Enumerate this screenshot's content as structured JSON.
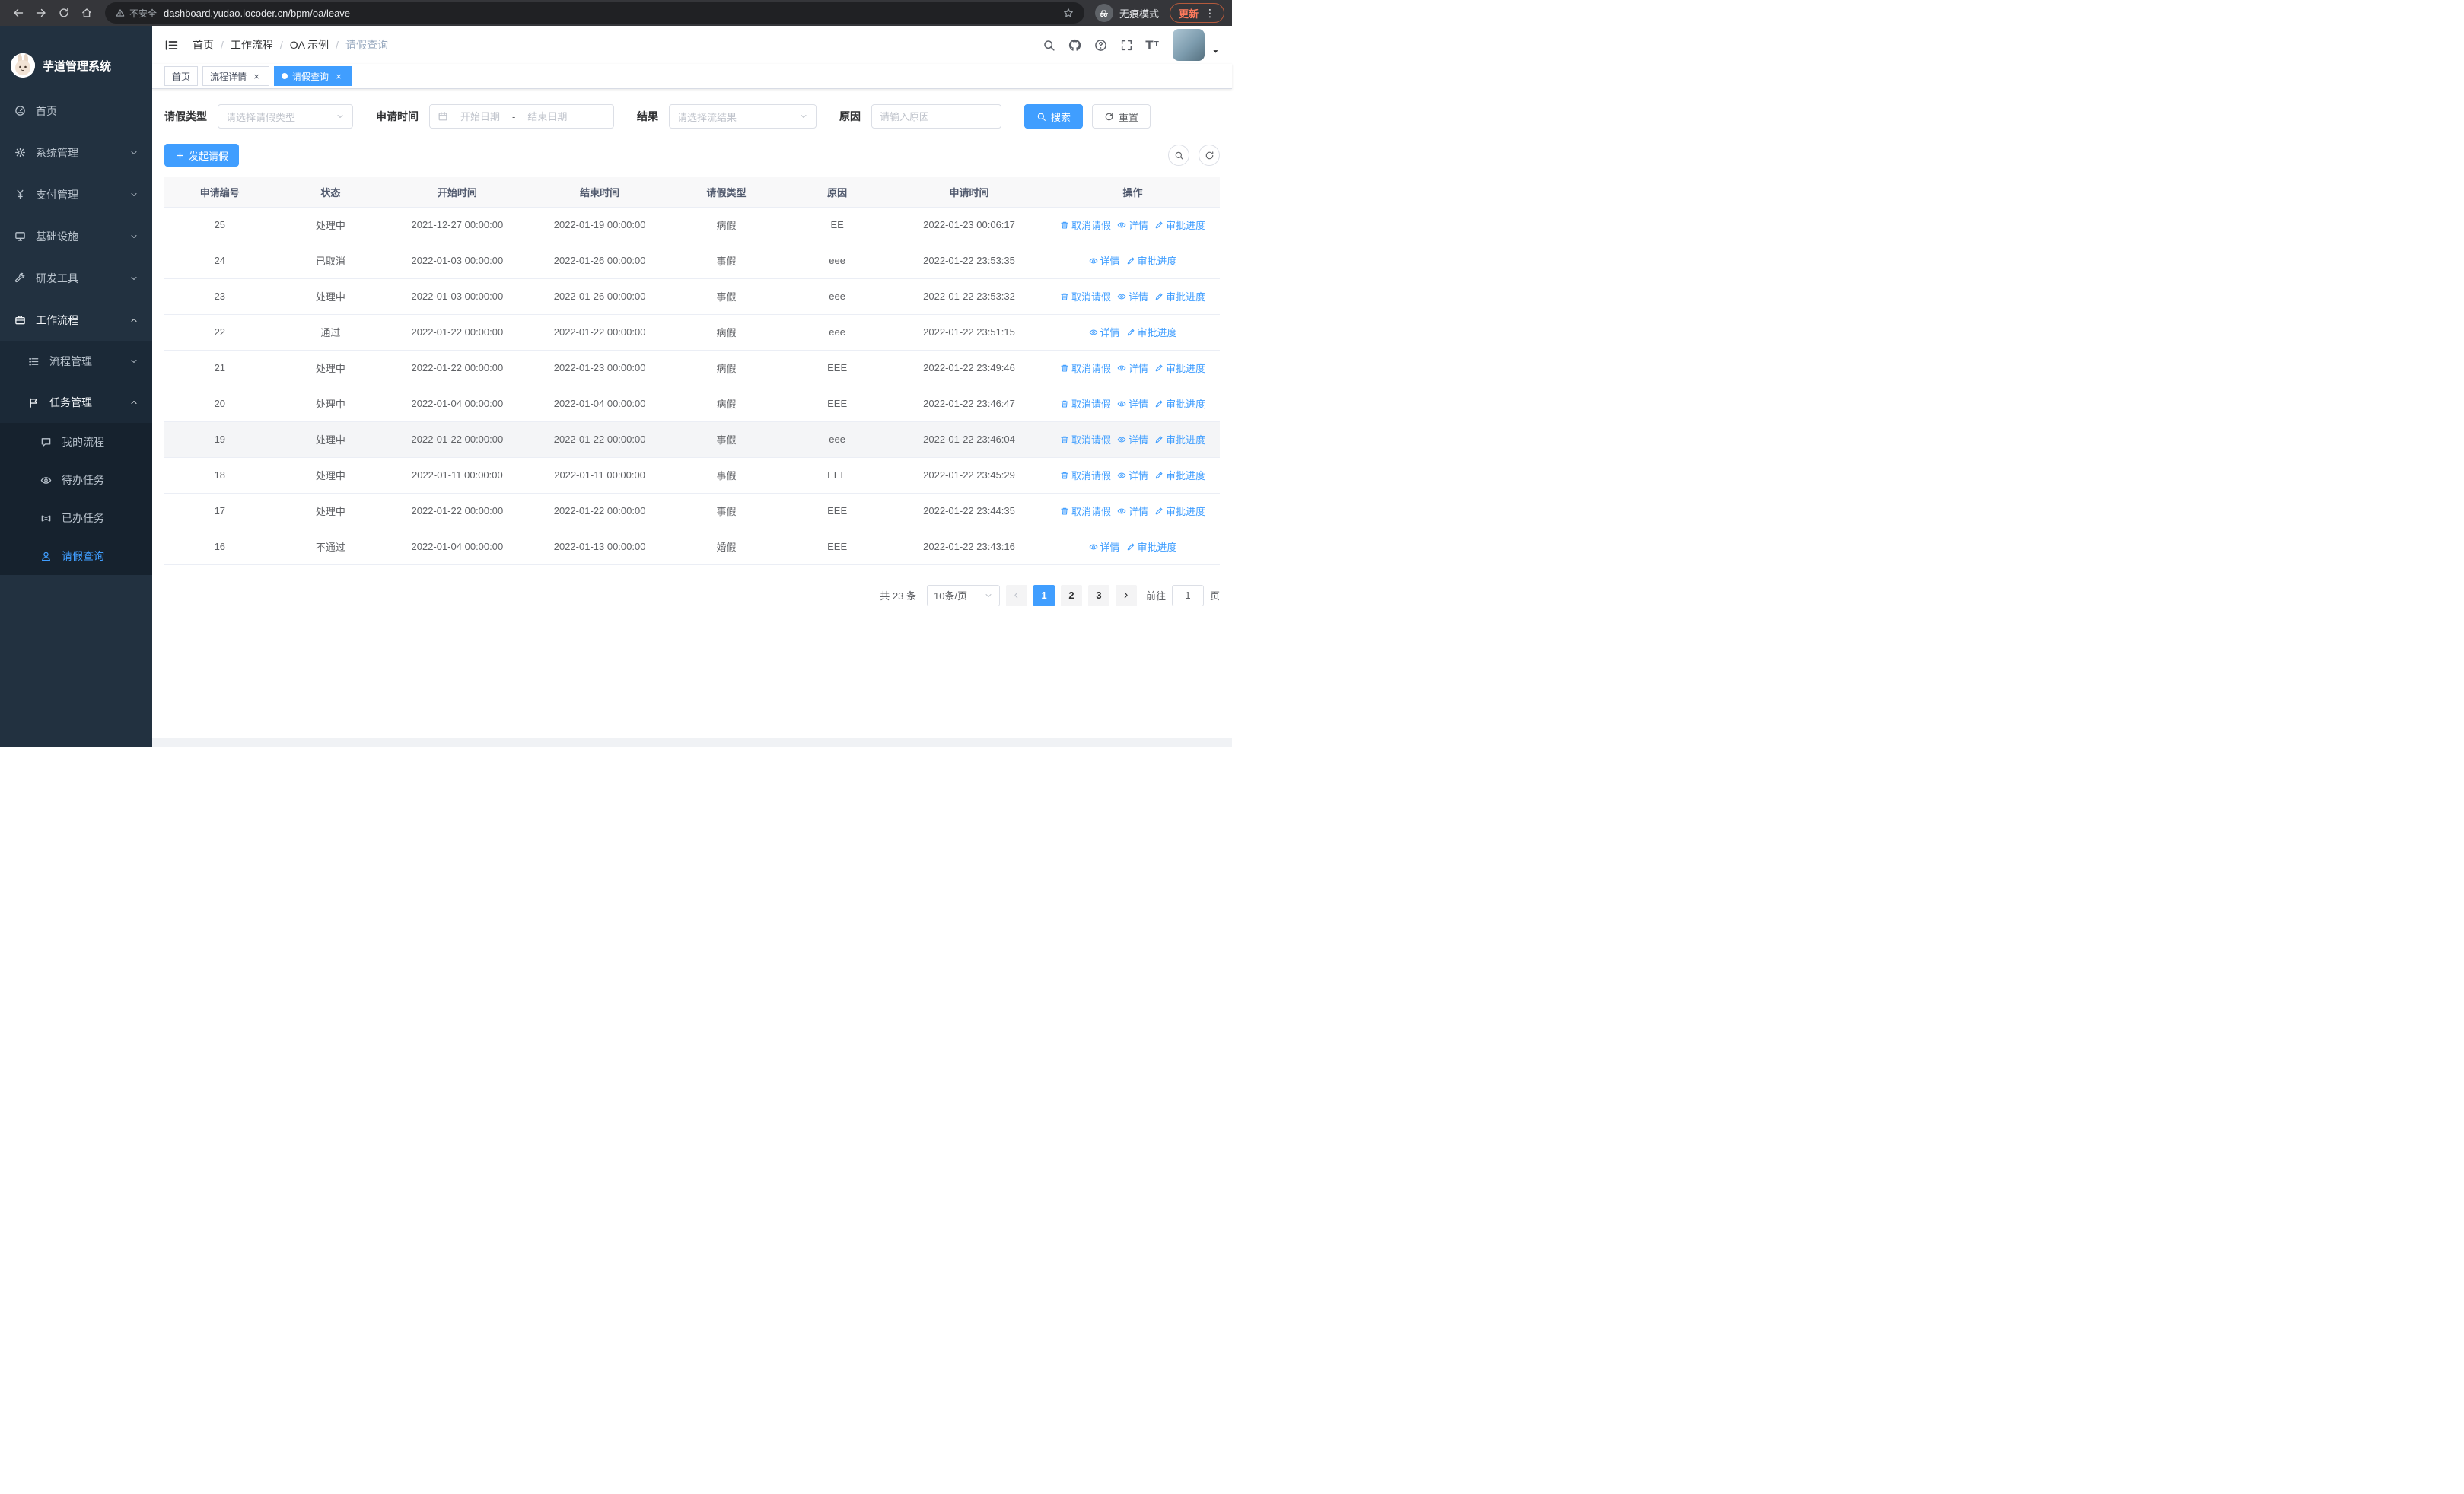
{
  "browser": {
    "security_label": "不安全",
    "url": "dashboard.yudao.iocoder.cn/bpm/oa/leave",
    "incognito_label": "无痕模式",
    "update_label": "更新"
  },
  "sidebar": {
    "app_title": "芋道管理系统",
    "menu": [
      {
        "key": "home",
        "label": "首页",
        "icon": "dashboard-icon",
        "level": 1
      },
      {
        "key": "system",
        "label": "系统管理",
        "icon": "gear-icon",
        "level": 1,
        "arrow": "down"
      },
      {
        "key": "payment",
        "label": "支付管理",
        "icon": "yen-icon",
        "level": 1,
        "arrow": "down"
      },
      {
        "key": "infrastructure",
        "label": "基础设施",
        "icon": "infra-icon",
        "level": 1,
        "arrow": "down"
      },
      {
        "key": "devtools",
        "label": "研发工具",
        "icon": "tools-icon",
        "level": 1,
        "arrow": "down"
      },
      {
        "key": "workflow",
        "label": "工作流程",
        "icon": "briefcase-icon",
        "level": 1,
        "arrow": "up",
        "open": true
      },
      {
        "key": "process-management",
        "label": "流程管理",
        "icon": "list-icon",
        "level": 2,
        "arrow": "down"
      },
      {
        "key": "task-management",
        "label": "任务管理",
        "icon": "flag-icon",
        "level": 2,
        "arrow": "up",
        "open": true
      },
      {
        "key": "my-process",
        "label": "我的流程",
        "icon": "chat-icon",
        "level": 3
      },
      {
        "key": "todo-tasks",
        "label": "待办任务",
        "icon": "eye-icon",
        "level": 3
      },
      {
        "key": "done-tasks",
        "label": "已办任务",
        "icon": "bowtie-icon",
        "level": 3
      },
      {
        "key": "leave-query",
        "label": "请假查询",
        "icon": "user-icon",
        "level": 3,
        "active": true
      }
    ]
  },
  "header": {
    "breadcrumb": [
      "首页",
      "工作流程",
      "OA 示例",
      "请假查询"
    ],
    "crumb_separator": "/"
  },
  "tags": [
    {
      "key": "home",
      "label": "首页",
      "closable": false,
      "active": false
    },
    {
      "key": "process-detail",
      "label": "流程详情",
      "closable": true,
      "active": false
    },
    {
      "key": "leave-query",
      "label": "请假查询",
      "closable": true,
      "active": true
    }
  ],
  "filters": {
    "leave_type_label": "请假类型",
    "leave_type_placeholder": "请选择请假类型",
    "apply_time_label": "申请时间",
    "start_date_placeholder": "开始日期",
    "end_date_placeholder": "结束日期",
    "range_separator": "-",
    "result_label": "结果",
    "result_placeholder": "请选择流结果",
    "reason_label": "原因",
    "reason_placeholder": "请输入原因",
    "search_label": "搜索",
    "reset_label": "重置"
  },
  "toolbar": {
    "create_label": "发起请假"
  },
  "table": {
    "columns": [
      "申请编号",
      "状态",
      "开始时间",
      "结束时间",
      "请假类型",
      "原因",
      "申请时间",
      "操作"
    ],
    "action_labels": {
      "cancel": "取消请假",
      "detail": "详情",
      "progress": "审批进度"
    },
    "rows": [
      {
        "id": "25",
        "status": "处理中",
        "start_time": "2021-12-27 00:00:00",
        "end_time": "2022-01-19 00:00:00",
        "leave_type": "病假",
        "reason": "EE",
        "apply_time": "2022-01-23 00:06:17",
        "actions": [
          "cancel",
          "detail",
          "progress"
        ],
        "highlight": false
      },
      {
        "id": "24",
        "status": "已取消",
        "start_time": "2022-01-03 00:00:00",
        "end_time": "2022-01-26 00:00:00",
        "leave_type": "事假",
        "reason": "eee",
        "apply_time": "2022-01-22 23:53:35",
        "actions": [
          "detail",
          "progress"
        ],
        "highlight": false
      },
      {
        "id": "23",
        "status": "处理中",
        "start_time": "2022-01-03 00:00:00",
        "end_time": "2022-01-26 00:00:00",
        "leave_type": "事假",
        "reason": "eee",
        "apply_time": "2022-01-22 23:53:32",
        "actions": [
          "cancel",
          "detail",
          "progress"
        ],
        "highlight": false
      },
      {
        "id": "22",
        "status": "通过",
        "start_time": "2022-01-22 00:00:00",
        "end_time": "2022-01-22 00:00:00",
        "leave_type": "病假",
        "reason": "eee",
        "apply_time": "2022-01-22 23:51:15",
        "actions": [
          "detail",
          "progress"
        ],
        "highlight": false
      },
      {
        "id": "21",
        "status": "处理中",
        "start_time": "2022-01-22 00:00:00",
        "end_time": "2022-01-23 00:00:00",
        "leave_type": "病假",
        "reason": "EEE",
        "apply_time": "2022-01-22 23:49:46",
        "actions": [
          "cancel",
          "detail",
          "progress"
        ],
        "highlight": false
      },
      {
        "id": "20",
        "status": "处理中",
        "start_time": "2022-01-04 00:00:00",
        "end_time": "2022-01-04 00:00:00",
        "leave_type": "病假",
        "reason": "EEE",
        "apply_time": "2022-01-22 23:46:47",
        "actions": [
          "cancel",
          "detail",
          "progress"
        ],
        "highlight": false
      },
      {
        "id": "19",
        "status": "处理中",
        "start_time": "2022-01-22 00:00:00",
        "end_time": "2022-01-22 00:00:00",
        "leave_type": "事假",
        "reason": "eee",
        "apply_time": "2022-01-22 23:46:04",
        "actions": [
          "cancel",
          "detail",
          "progress"
        ],
        "highlight": true
      },
      {
        "id": "18",
        "status": "处理中",
        "start_time": "2022-01-11 00:00:00",
        "end_time": "2022-01-11 00:00:00",
        "leave_type": "事假",
        "reason": "EEE",
        "apply_time": "2022-01-22 23:45:29",
        "actions": [
          "cancel",
          "detail",
          "progress"
        ],
        "highlight": false
      },
      {
        "id": "17",
        "status": "处理中",
        "start_time": "2022-01-22 00:00:00",
        "end_time": "2022-01-22 00:00:00",
        "leave_type": "事假",
        "reason": "EEE",
        "apply_time": "2022-01-22 23:44:35",
        "actions": [
          "cancel",
          "detail",
          "progress"
        ],
        "highlight": false
      },
      {
        "id": "16",
        "status": "不通过",
        "start_time": "2022-01-04 00:00:00",
        "end_time": "2022-01-13 00:00:00",
        "leave_type": "婚假",
        "reason": "EEE",
        "apply_time": "2022-01-22 23:43:16",
        "actions": [
          "detail",
          "progress"
        ],
        "highlight": false
      }
    ]
  },
  "pagination": {
    "total_text": "共 23 条",
    "page_size": "10条/页",
    "pages": [
      "1",
      "2",
      "3"
    ],
    "active_page": "1",
    "goto_label": "前往",
    "goto_value": "1",
    "unit_label": "页"
  },
  "colors": {
    "primary": "#409eff",
    "sidebar_bg": "#223140",
    "update_accent": "#ff7a5c"
  }
}
